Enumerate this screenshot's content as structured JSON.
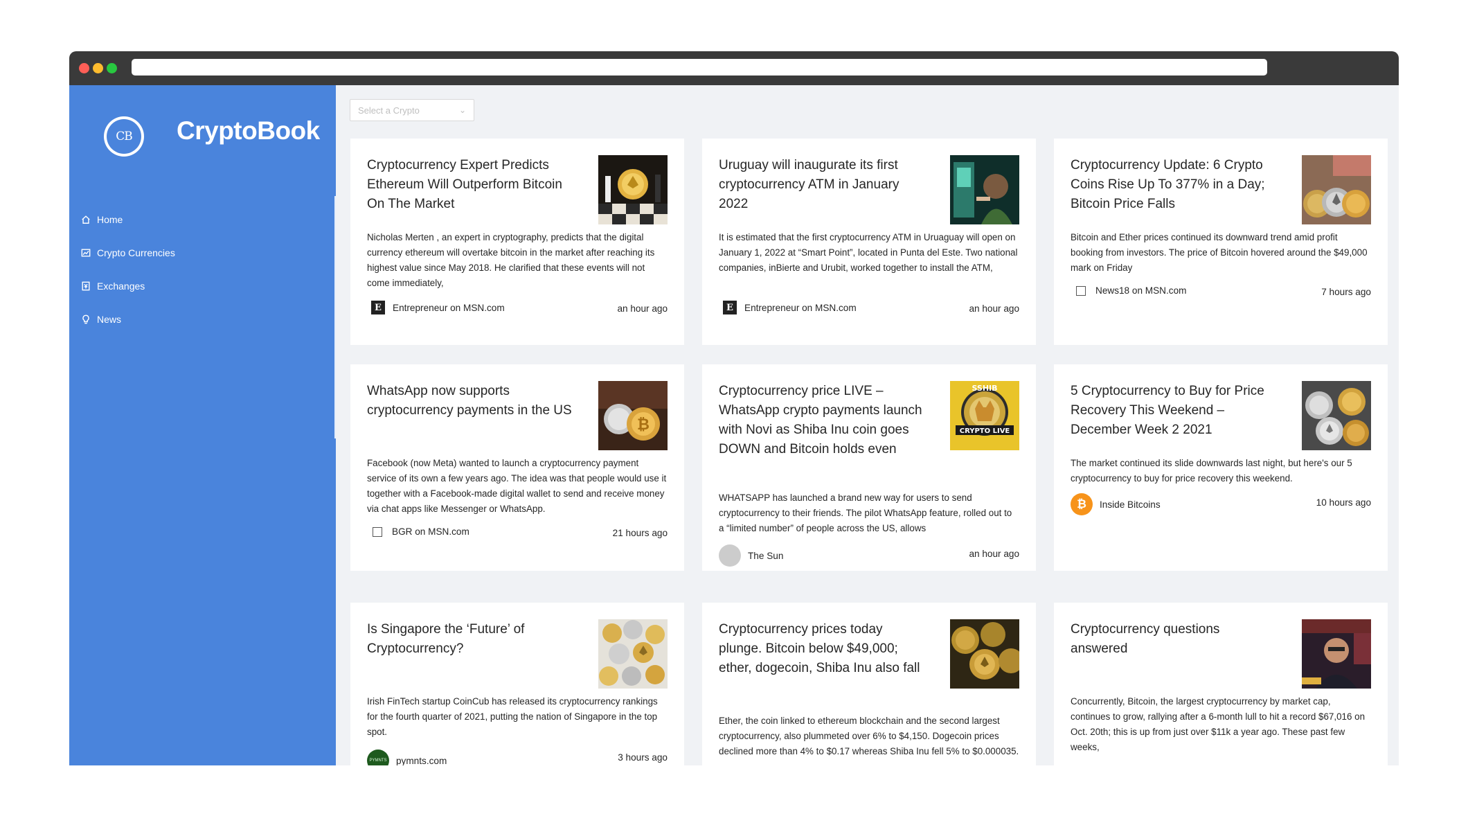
{
  "app": {
    "title": "CryptoBook",
    "logo_text": "CB"
  },
  "sidebar": {
    "items": [
      {
        "label": "Home",
        "icon": "home-icon"
      },
      {
        "label": "Crypto Currencies",
        "icon": "fund-icon"
      },
      {
        "label": "Exchanges",
        "icon": "money-collect-icon"
      },
      {
        "label": "News",
        "icon": "bulb-icon"
      }
    ]
  },
  "select": {
    "placeholder": "Select a Crypto"
  },
  "cards": [
    {
      "title": "Cryptocurrency Expert Predicts Ethereum Will Outperform Bitcoin On The Market",
      "description": "Nicholas Merten , an expert in cryptography, predicts that the digital currency ethereum will overtake bitcoin in the market after reaching its highest value since May 2018. He clarified that these events will not come immediately,",
      "provider": "Entrepreneur on MSN.com",
      "time": "an hour ago"
    },
    {
      "title": "Uruguay will inaugurate its first cryptocurrency ATM in January 2022",
      "description": "It is estimated that the first cryptocurrency ATM in Uruaguay will open on January 1, 2022 at “Smart Point”, located in Punta del Este. Two national companies, inBierte and Urubit, worked together to install the ATM,",
      "provider": "Entrepreneur on MSN.com",
      "time": "an hour ago"
    },
    {
      "title": "Cryptocurrency Update: 6 Crypto Coins Rise Up To 377% in a Day; Bitcoin Price Falls",
      "description": "Bitcoin and Ether prices continued its downward trend amid profit booking from investors. The price of Bitcoin hovered around the $49,000 mark on Friday",
      "provider": "News18 on MSN.com",
      "time": "7 hours ago"
    },
    {
      "title": "WhatsApp now supports cryptocurrency payments in the US",
      "description": "Facebook (now Meta) wanted to launch a cryptocurrency payment service of its own a few years ago. The idea was that people would use it together with a Facebook-made digital wallet to send and receive money via chat apps like Messenger or WhatsApp.",
      "provider": "BGR on MSN.com",
      "time": "21 hours ago"
    },
    {
      "title": "Cryptocurrency price LIVE – WhatsApp crypto payments launch with Novi as Shiba Inu coin goes DOWN and Bitcoin holds even",
      "description": "WHATSAPP has launched a brand new way for users to send cryptocurrency to their friends. The pilot WhatsApp feature, rolled out to a “limited number” of people across the US, allows",
      "provider": "The Sun",
      "time": "an hour ago"
    },
    {
      "title": "5 Cryptocurrency to Buy for Price Recovery This Weekend – December Week 2 2021",
      "description": "The market continued its slide downwards last night, but here's our 5 cryptocurrency to buy for price recovery this weekend.",
      "provider": "Inside Bitcoins",
      "time": "10 hours ago"
    },
    {
      "title": "Is Singapore the ‘Future’ of Cryptocurrency?",
      "description": "Irish FinTech startup CoinCub has released its cryptocurrency rankings for the fourth quarter of 2021, putting the nation of Singapore in the top spot.",
      "provider": "pymnts.com",
      "time": "3 hours ago"
    },
    {
      "title": "Cryptocurrency prices today plunge. Bitcoin below $49,000; ether, dogecoin, Shiba Inu also fall",
      "description": "Ether, the coin linked to ethereum blockchain and the second largest cryptocurrency, also plummeted over 6% to $4,150. Dogecoin prices declined more than 4% to $0.17 whereas Shiba Inu fell 5% to $0.000035.",
      "provider": "",
      "time": ""
    },
    {
      "title": "Cryptocurrency questions answered",
      "description": "Concurrently, Bitcoin, the largest cryptocurrency by market cap, continues to grow, rallying after a 6-month lull to hit a record $67,016 on Oct. 20th; this is up from just over $11k a year ago. These past few weeks,",
      "provider": "",
      "time": ""
    }
  ],
  "thumb_labels": {
    "shib": "SSHIB",
    "crypto_live": "CRYPTO LIVE",
    "pymnts": "PYMNTS"
  }
}
